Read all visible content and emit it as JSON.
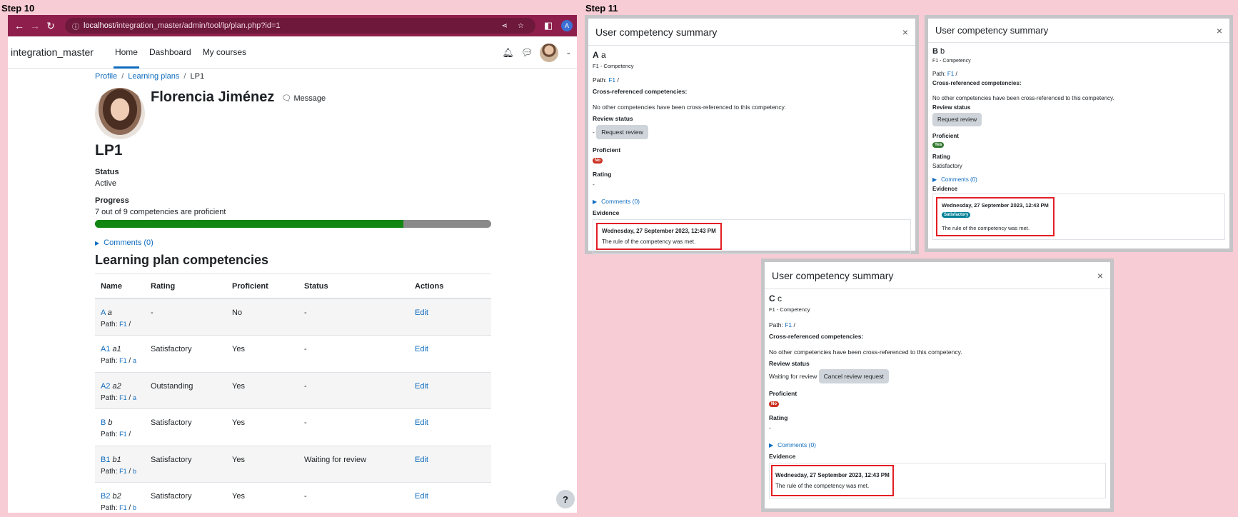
{
  "steps": {
    "left": "Step 10",
    "right": "Step 11"
  },
  "browser": {
    "url_host": "localhost",
    "url_path": "/integration_master/admin/tool/lp/plan.php?id=1",
    "profile_initial": "A"
  },
  "site": {
    "name": "integration_master",
    "nav": [
      "Home",
      "Dashboard",
      "My courses"
    ]
  },
  "breadcrumb": [
    "Profile",
    "Learning plans",
    "LP1"
  ],
  "user": {
    "name": "Florencia Jiménez",
    "message_label": "Message"
  },
  "plan": {
    "title": "LP1",
    "status_label": "Status",
    "status_value": "Active",
    "progress_label": "Progress",
    "progress_text": "7 out of 9 competencies are proficient",
    "progress_fraction": 0.7778,
    "comments_label": "Comments (0)",
    "section_title": "Learning plan competencies"
  },
  "table": {
    "headers": [
      "Name",
      "Rating",
      "Proficient",
      "Status",
      "Actions"
    ],
    "path_label": "Path:",
    "rows": [
      {
        "short": "A",
        "name": "a",
        "path1": "F1",
        "path2": "",
        "rating": "-",
        "proficient": "No",
        "status": "-",
        "action": "Edit"
      },
      {
        "short": "A1",
        "name": "a1",
        "path1": "F1",
        "path2": "a",
        "rating": "Satisfactory",
        "proficient": "Yes",
        "status": "-",
        "action": "Edit"
      },
      {
        "short": "A2",
        "name": "a2",
        "path1": "F1",
        "path2": "a",
        "rating": "Outstanding",
        "proficient": "Yes",
        "status": "-",
        "action": "Edit"
      },
      {
        "short": "B",
        "name": "b",
        "path1": "F1",
        "path2": "",
        "rating": "Satisfactory",
        "proficient": "Yes",
        "status": "-",
        "action": "Edit"
      },
      {
        "short": "B1",
        "name": "b1",
        "path1": "F1",
        "path2": "b",
        "rating": "Satisfactory",
        "proficient": "Yes",
        "status": "Waiting for review",
        "action": "Edit"
      },
      {
        "short": "B2",
        "name": "b2",
        "path1": "F1",
        "path2": "b",
        "rating": "Satisfactory",
        "proficient": "Yes",
        "status": "-",
        "action": "Edit"
      }
    ]
  },
  "help_label": "?",
  "modal_common": {
    "title": "User competency summary",
    "close": "×",
    "framework": "F1 - Competency",
    "path_label": "Path:",
    "path_value": "F1",
    "cross_ref_label": "Cross-referenced competencies:",
    "cross_ref_text": "No other competencies have been cross-referenced to this competency.",
    "review_label": "Review status",
    "proficient_label": "Proficient",
    "rating_label": "Rating",
    "comments_label": "Comments (0)",
    "evidence_label": "Evidence",
    "evidence_date": "Wednesday, 27 September 2023, 12:43 PM",
    "evidence_text": "The rule of the competency was met."
  },
  "modal_a": {
    "short": "A",
    "name": "a",
    "review_prefix": "-",
    "review_button": "Request review",
    "proficient_badge": "No",
    "rating_value": "-"
  },
  "modal_b": {
    "short": "B",
    "name": "b",
    "review_button": "Request review",
    "proficient_badge": "Yes",
    "rating_value": "Satisfactory",
    "evidence_badge": "Satisfactory"
  },
  "modal_c": {
    "short": "C",
    "name": "c",
    "review_prefix": "Waiting for review",
    "review_button": "Cancel review request",
    "proficient_badge": "No",
    "rating_value": "-"
  }
}
